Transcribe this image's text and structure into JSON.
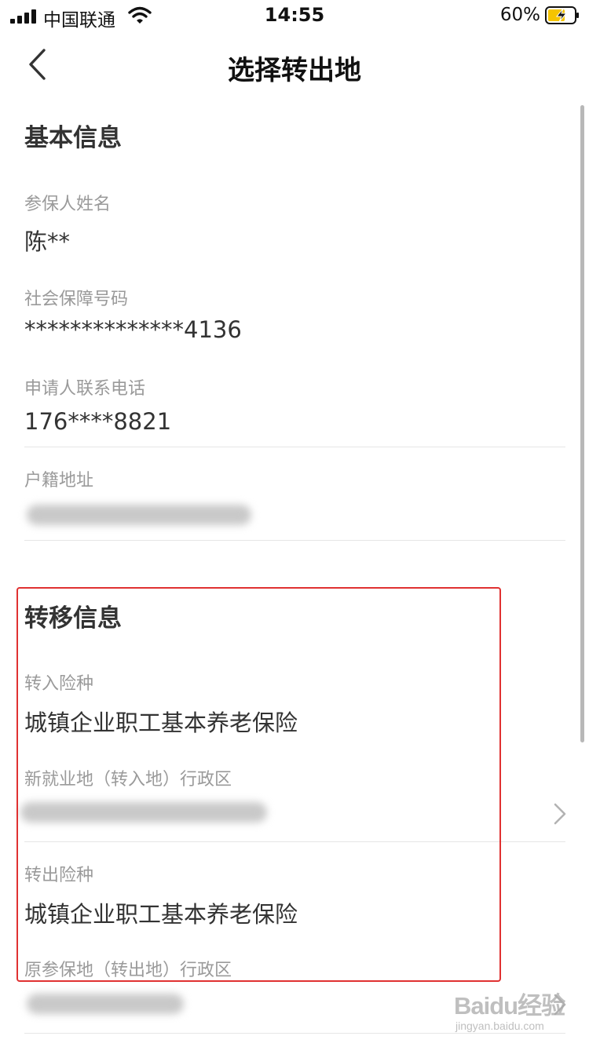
{
  "status_bar": {
    "carrier": "中国联通",
    "time": "14:55",
    "battery": "60%"
  },
  "nav": {
    "title": "选择转出地",
    "back_icon": "chevron-left-icon"
  },
  "basic_info": {
    "title": "基本信息",
    "fields": [
      {
        "label": "参保人姓名",
        "value": "陈**"
      },
      {
        "label": "社会保障号码",
        "value": "**************4136"
      },
      {
        "label": "申请人联系电话",
        "value": "176****8821"
      },
      {
        "label": "户籍地址"
      }
    ]
  },
  "transfer_info": {
    "title": "转移信息",
    "fields": [
      {
        "label": "转入险种",
        "value": "城镇企业职工基本养老保险"
      },
      {
        "label": "新就业地（转入地）行政区"
      },
      {
        "label": "转出险种",
        "value": "城镇企业职工基本养老保险"
      },
      {
        "label": "原参保地（转出地）行政区"
      }
    ]
  },
  "colors": {
    "highlight": "#e03131",
    "battery_fill": "#f5c400"
  },
  "watermark": {
    "main": "Baidu经验",
    "sub": "jingyan.baidu.com"
  }
}
